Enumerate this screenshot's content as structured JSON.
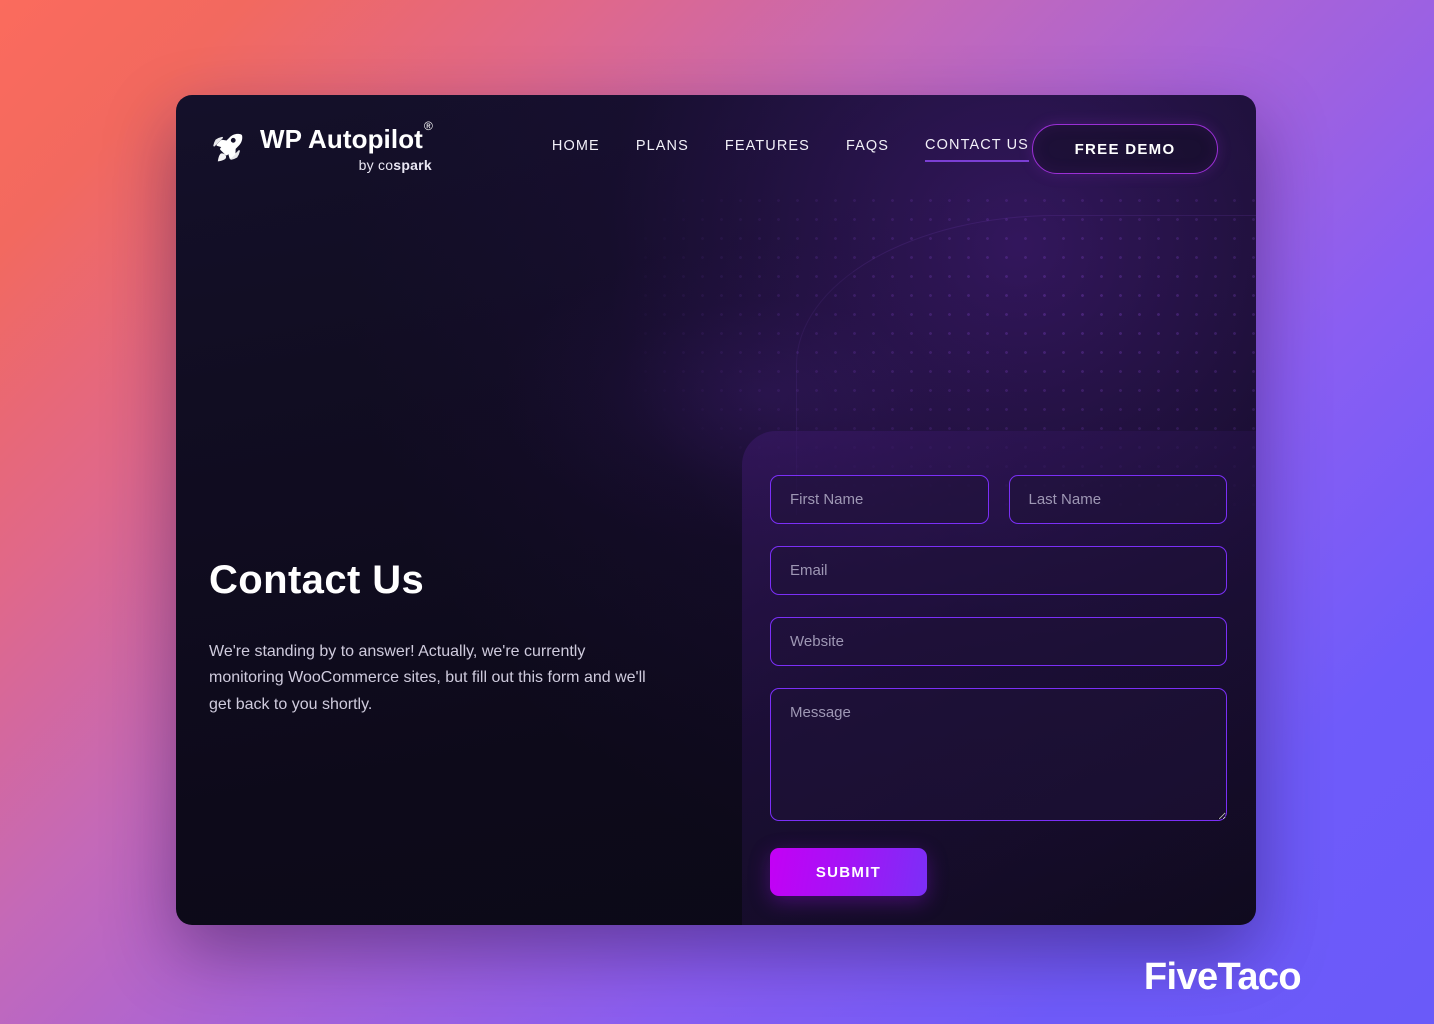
{
  "background": {
    "gradient_from": "#fb6b5d",
    "gradient_mid": "#a863d8",
    "gradient_to": "#6a5af9"
  },
  "card": {
    "background": "#0d0a1a"
  },
  "header": {
    "brand": {
      "logo_icon": "rocket-icon",
      "title": "WP Autopilot",
      "registered_mark": "®",
      "sub_light": "by co",
      "sub_bold": "spark"
    },
    "nav": [
      {
        "label": "HOME",
        "active": false
      },
      {
        "label": "PLANS",
        "active": false
      },
      {
        "label": "FEATURES",
        "active": false
      },
      {
        "label": "FAQS",
        "active": false
      },
      {
        "label": "CONTACT US",
        "active": true
      }
    ],
    "cta": {
      "label": "FREE DEMO",
      "border_color": "#9b2fd6"
    }
  },
  "hero": {
    "title": "Contact Us",
    "text": "We're standing by to answer! Actually, we're currently monitoring WooCommerce sites, but fill out this form and we'll get back to you shortly."
  },
  "form": {
    "accent_color": "#7b2ff7",
    "fields": {
      "first_name": {
        "placeholder": "First Name",
        "value": ""
      },
      "last_name": {
        "placeholder": "Last Name",
        "value": ""
      },
      "email": {
        "placeholder": "Email",
        "value": ""
      },
      "website": {
        "placeholder": "Website",
        "value": ""
      },
      "message": {
        "placeholder": "Message",
        "value": ""
      }
    },
    "submit": {
      "label": "SUBMIT",
      "gradient_from": "#c400f5",
      "gradient_to": "#7b2ff7"
    }
  },
  "watermark": {
    "label": "FiveTaco"
  }
}
